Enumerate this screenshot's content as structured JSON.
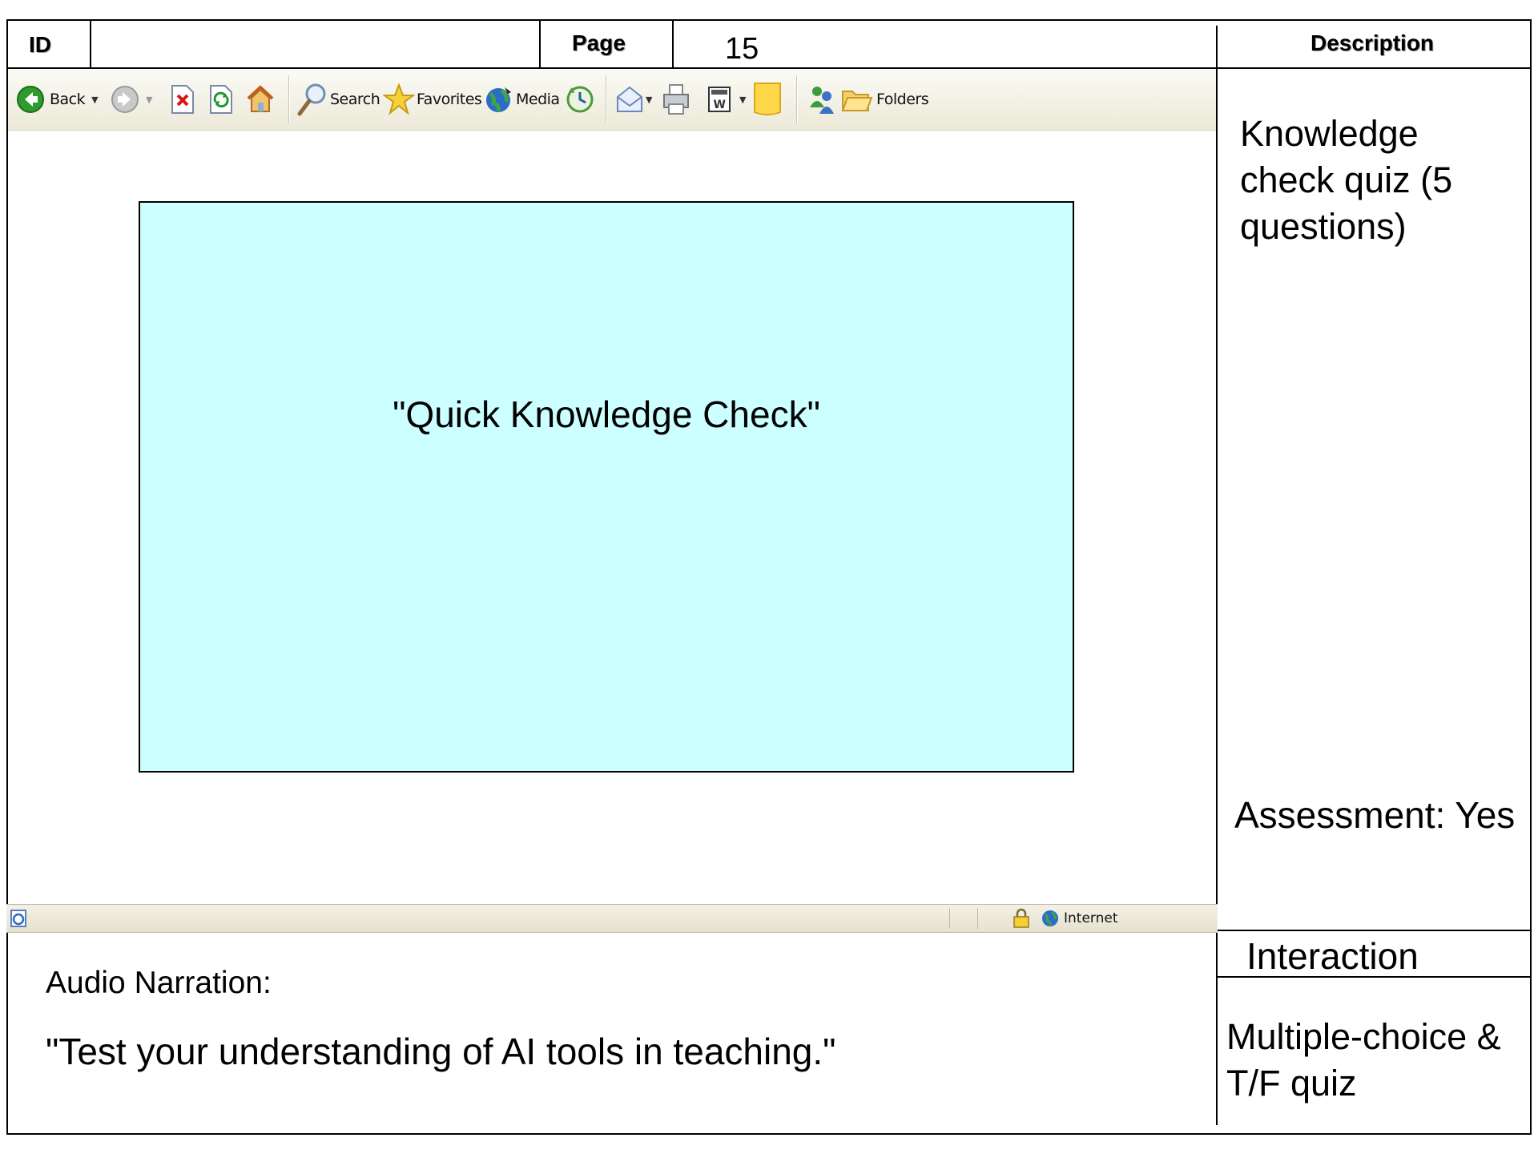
{
  "header": {
    "id_label": "ID",
    "id_value": "",
    "page_label": "Page",
    "page_value": "15",
    "description_label": "Description"
  },
  "toolbar": {
    "back_label": "Back",
    "search_label": "Search",
    "favorites_label": "Favorites",
    "media_label": "Media",
    "folders_label": "Folders"
  },
  "content": {
    "box_text": "\"Quick Knowledge Check\""
  },
  "statusbar": {
    "zone_label": "Internet"
  },
  "description": {
    "text": "Knowledge check quiz (5 questions)",
    "assessment": "Assessment: Yes"
  },
  "interaction": {
    "label": "Interaction",
    "text": "Multiple-choice & T/F quiz"
  },
  "audio": {
    "label": "Audio Narration:",
    "text": "\"Test your understanding of AI tools in teaching.\""
  },
  "colors": {
    "content_box_fill": "#ccffff",
    "toolbar_bg": "#ece9d8",
    "back_icon_green": "#2e9b2e"
  }
}
